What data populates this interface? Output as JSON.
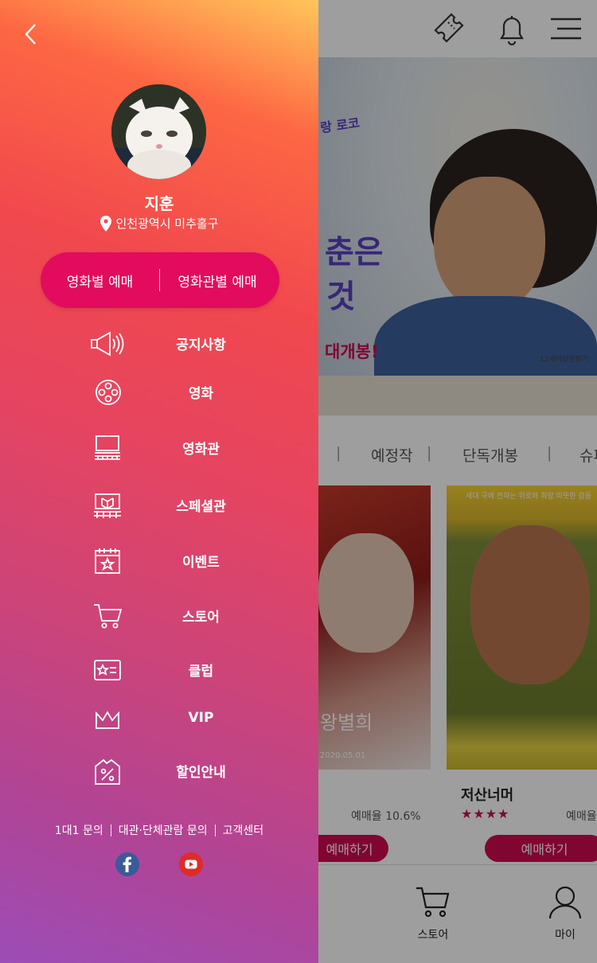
{
  "drawer": {
    "user": {
      "name": "지훈",
      "location": "인천광역시 미추홀구"
    },
    "booking": {
      "by_movie": "영화별 예매",
      "by_theater": "영화관별 예매"
    },
    "menu": [
      {
        "label": "공지사항",
        "icon": "megaphone-icon"
      },
      {
        "label": "영화",
        "icon": "film-reel-icon"
      },
      {
        "label": "영화관",
        "icon": "theater-screen-icon"
      },
      {
        "label": "스페셜관",
        "icon": "special-theater-icon"
      },
      {
        "label": "이벤트",
        "icon": "event-calendar-icon"
      },
      {
        "label": "스토어",
        "icon": "cart-icon"
      },
      {
        "label": "클럽",
        "icon": "membership-card-icon"
      },
      {
        "label": "VIP",
        "icon": "crown-icon"
      },
      {
        "label": "할인안내",
        "icon": "discount-tag-icon"
      }
    ],
    "footer": {
      "links": [
        "1대1 문의",
        "대관·단체관람 문의",
        "고객센터"
      ]
    },
    "social": [
      "facebook-icon",
      "youtube-icon"
    ],
    "colors": {
      "gradient_top": "#ffc65a",
      "gradient_mid": "#f1484e",
      "gradient_bottom": "#9c4db7",
      "booking_pill": "#e20b5e"
    }
  },
  "background": {
    "hero": {
      "text_a": "랑 로코",
      "text_b": "춘은",
      "text_c": "것",
      "text_d": "대개봉!",
      "age_badge": "12세이상관람가"
    },
    "tabs": [
      "예정작",
      "단독개봉",
      "슈퍼"
    ],
    "movies": [
      {
        "title": "",
        "rate": "예매율 10.6%",
        "book": "예매하기",
        "poster_text": "왕별희",
        "poster_date": "2020.05.01"
      },
      {
        "title": "저산너머",
        "rate": "예매율",
        "stars": "★★★★",
        "book": "예매하기",
        "poster_top": "세대 국에 전하는 위로와 희망 따뜻한 감동"
      }
    ],
    "bottom_nav": [
      {
        "label": "스토어",
        "icon": "cart-icon"
      },
      {
        "label": "마이",
        "icon": "user-icon"
      }
    ],
    "accent": "#d0094f"
  }
}
